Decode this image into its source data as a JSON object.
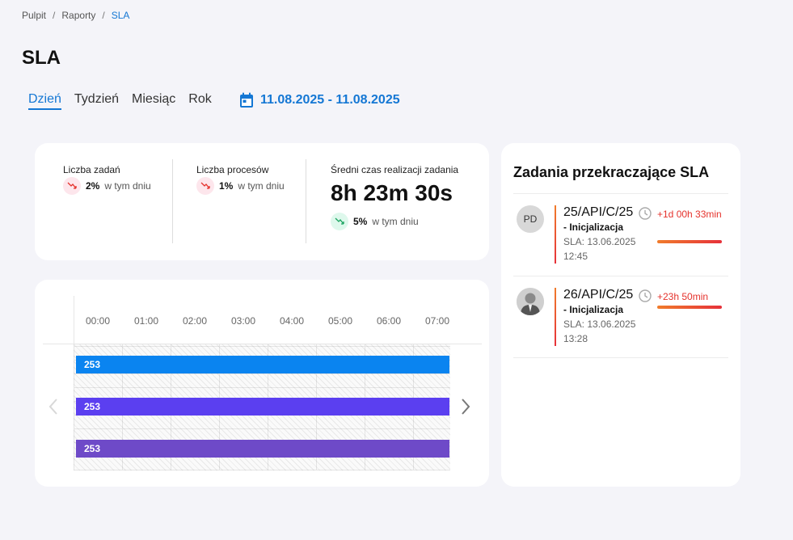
{
  "breadcrumb": {
    "home": "Pulpit",
    "reports": "Raporty",
    "current": "SLA",
    "sep": "/"
  },
  "page": {
    "title": "SLA"
  },
  "tabs": [
    {
      "label": "Dzień",
      "active": true
    },
    {
      "label": "Tydzień",
      "active": false
    },
    {
      "label": "Miesiąc",
      "active": false
    },
    {
      "label": "Rok",
      "active": false
    }
  ],
  "date_range": {
    "label": "11.08.2025 - 11.08.2025",
    "icon": "calendar-icon"
  },
  "stats": {
    "tasks": {
      "label": "Liczba zadań",
      "percent": "2%",
      "suffix": "w tym dniu",
      "trend": "down"
    },
    "processes": {
      "label": "Liczba procesów",
      "percent": "1%",
      "suffix": "w tym dniu",
      "trend": "down"
    },
    "avg_time": {
      "label": "Średni czas realizacji zadania",
      "value": "8h 23m 30s",
      "percent": "5%",
      "suffix": "w tym dniu",
      "trend": "up"
    }
  },
  "timeline": {
    "hours": [
      "00:00",
      "01:00",
      "02:00",
      "03:00",
      "04:00",
      "05:00",
      "06:00",
      "07:00"
    ],
    "bars": [
      {
        "label": "253",
        "color": "#0a84f0"
      },
      {
        "label": "253",
        "color": "#5b3ff0"
      },
      {
        "label": "253",
        "color": "#6e4ac8"
      }
    ]
  },
  "sla_panel": {
    "title": "Zadania przekraczające SLA",
    "items": [
      {
        "avatar_initials": "PD",
        "id": "25/API/C/25",
        "stage": "- Inicjalizacja",
        "sla_label": "SLA: 13.06.2025",
        "time": "12:45",
        "overdue": "+1d 00h 33min"
      },
      {
        "avatar_initials": "",
        "avatar_icon": "user-photo-icon",
        "id": "26/API/C/25",
        "stage": "- Inicjalizacja",
        "sla_label": "SLA: 13.06.2025",
        "time": "13:28",
        "overdue": "+23h 50min"
      }
    ]
  },
  "colors": {
    "accent": "#1477d4",
    "danger": "#e5322c",
    "warning": "#f07c2b"
  }
}
